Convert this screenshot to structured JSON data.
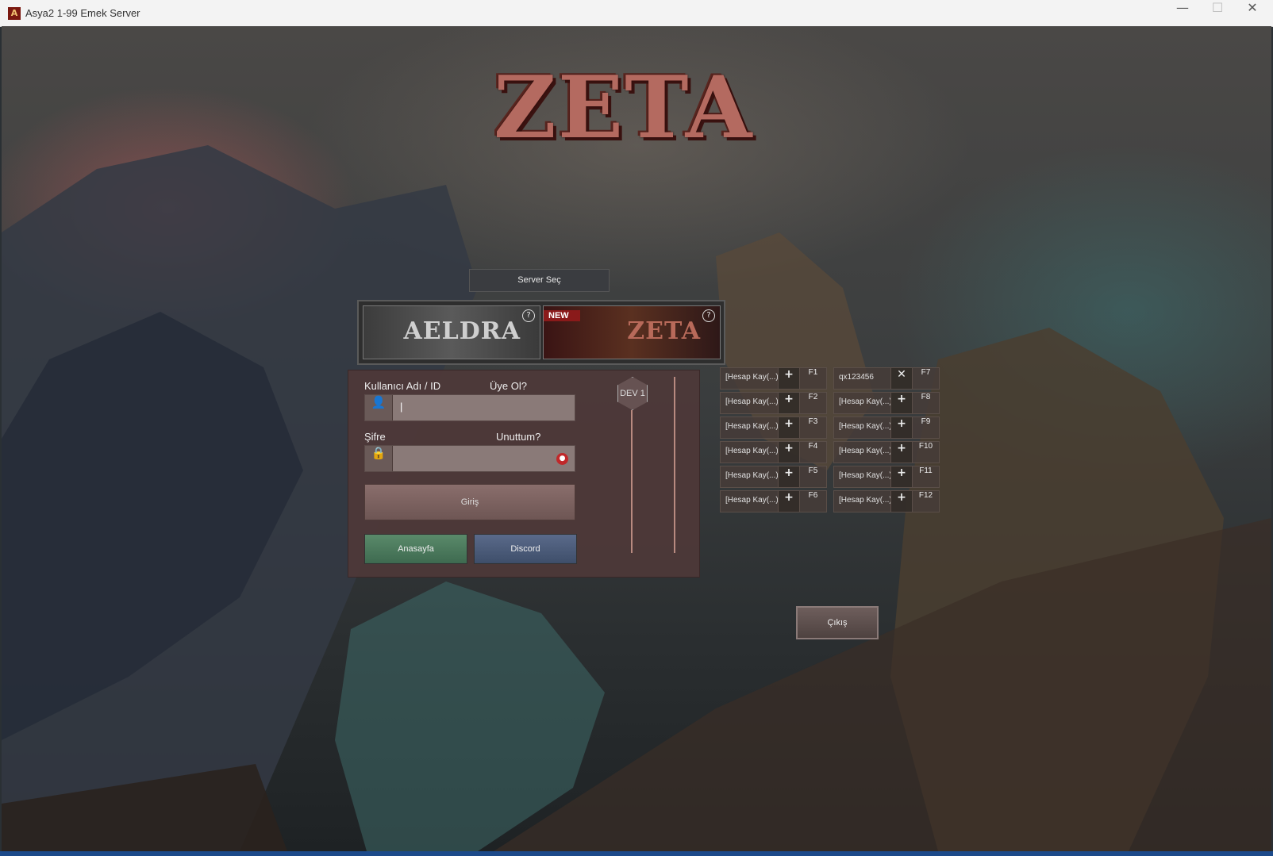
{
  "window": {
    "title": "Asya2 1-99 Emek Server",
    "controls": {
      "minimize": "—",
      "maximize": "☐",
      "close": "✕"
    }
  },
  "logo": "ZETA",
  "server_select": {
    "label": "Server Seç",
    "servers": [
      {
        "name": "AELDRA",
        "help": "?"
      },
      {
        "name": "ZETA",
        "badge": "NEW",
        "help": "?"
      }
    ]
  },
  "login": {
    "username_label": "Kullanıcı Adı / ID",
    "register_link": "Üye Ol?",
    "username_value": "|",
    "password_label": "Şifre",
    "forgot_link": "Unuttum?",
    "password_value": "",
    "login_button": "Giriş",
    "home_button": "Anasayfa",
    "discord_button": "Discord",
    "channel_badge": "DEV 1"
  },
  "account_slots": {
    "left": [
      {
        "name": "[Hesap Kay(...)",
        "key": "F1",
        "action_icon": "plus-icon"
      },
      {
        "name": "[Hesap Kay(...)",
        "key": "F2",
        "action_icon": "plus-icon"
      },
      {
        "name": "[Hesap Kay(...)",
        "key": "F3",
        "action_icon": "plus-icon"
      },
      {
        "name": "[Hesap Kay(...)",
        "key": "F4",
        "action_icon": "plus-icon"
      },
      {
        "name": "[Hesap Kay(...)",
        "key": "F5",
        "action_icon": "plus-icon"
      },
      {
        "name": "[Hesap Kay(...)",
        "key": "F6",
        "action_icon": "plus-icon"
      }
    ],
    "right": [
      {
        "name": "qx123456",
        "key": "F7",
        "action_icon": "remove-icon"
      },
      {
        "name": "[Hesap Kay(...)",
        "key": "F8",
        "action_icon": "plus-icon"
      },
      {
        "name": "[Hesap Kay(...)",
        "key": "F9",
        "action_icon": "plus-icon"
      },
      {
        "name": "[Hesap Kay(...)",
        "key": "F10",
        "action_icon": "plus-icon"
      },
      {
        "name": "[Hesap Kay(...)",
        "key": "F11",
        "action_icon": "plus-icon"
      },
      {
        "name": "[Hesap Kay(...)",
        "key": "F12",
        "action_icon": "plus-icon"
      }
    ],
    "icons": {
      "plus": "+",
      "remove": "✕"
    }
  },
  "exit_button": "Çıkış",
  "colors": {
    "panel": "#4e3838",
    "new_badge": "#8a1a1a",
    "home": "#4e7a5e",
    "discord": "#4e5e7a",
    "eye_icon": "#c0282a"
  }
}
